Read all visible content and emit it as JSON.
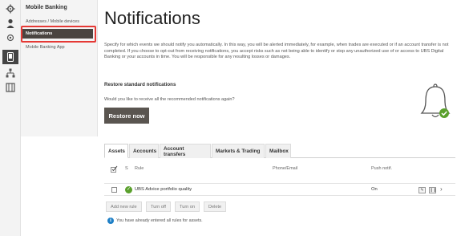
{
  "sidebar": {
    "heading": "Mobile Banking",
    "items": [
      {
        "label": "Addresses / Mobile devices"
      },
      {
        "label": "Notifications"
      },
      {
        "label": "Mobile Banking App"
      }
    ]
  },
  "page": {
    "title": "Notifications",
    "intro": "Specify for which events we should notify you automatically. In this way, you will be alerted immediately, for example, when trades are executed or if an account transfer is not completed. If you choose to opt-out from receiving notifications, you accept risks such as not being able to identify or stop any unauthorized use of or access to UBS Digital Banking or your accounts in time. You will be responsible for any resulting losses or damages."
  },
  "restore": {
    "heading": "Restore standard notifications",
    "question": "Would you like to receive all the recommended notifications again?",
    "button": "Restore now"
  },
  "tabs": [
    "Assets",
    "Accounts",
    "Account transfers",
    "Markets & Trading",
    "Mailbox"
  ],
  "table": {
    "headers": {
      "status": "S",
      "rule": "Rule",
      "phone_email": "Phone/Email",
      "push": "Push notif."
    },
    "rows": [
      {
        "rule": "UBS Advice portfolio quality",
        "push": "On"
      }
    ]
  },
  "actions": [
    "Add new rule",
    "Turn off",
    "Turn on",
    "Delete"
  ],
  "info_text": "You have already entered all rules for assets.",
  "colors": {
    "active_nav": "#4a4440",
    "button": "#5a5550",
    "ok": "#5aa02c",
    "info": "#1d7fc6",
    "highlight": "#e53935"
  }
}
